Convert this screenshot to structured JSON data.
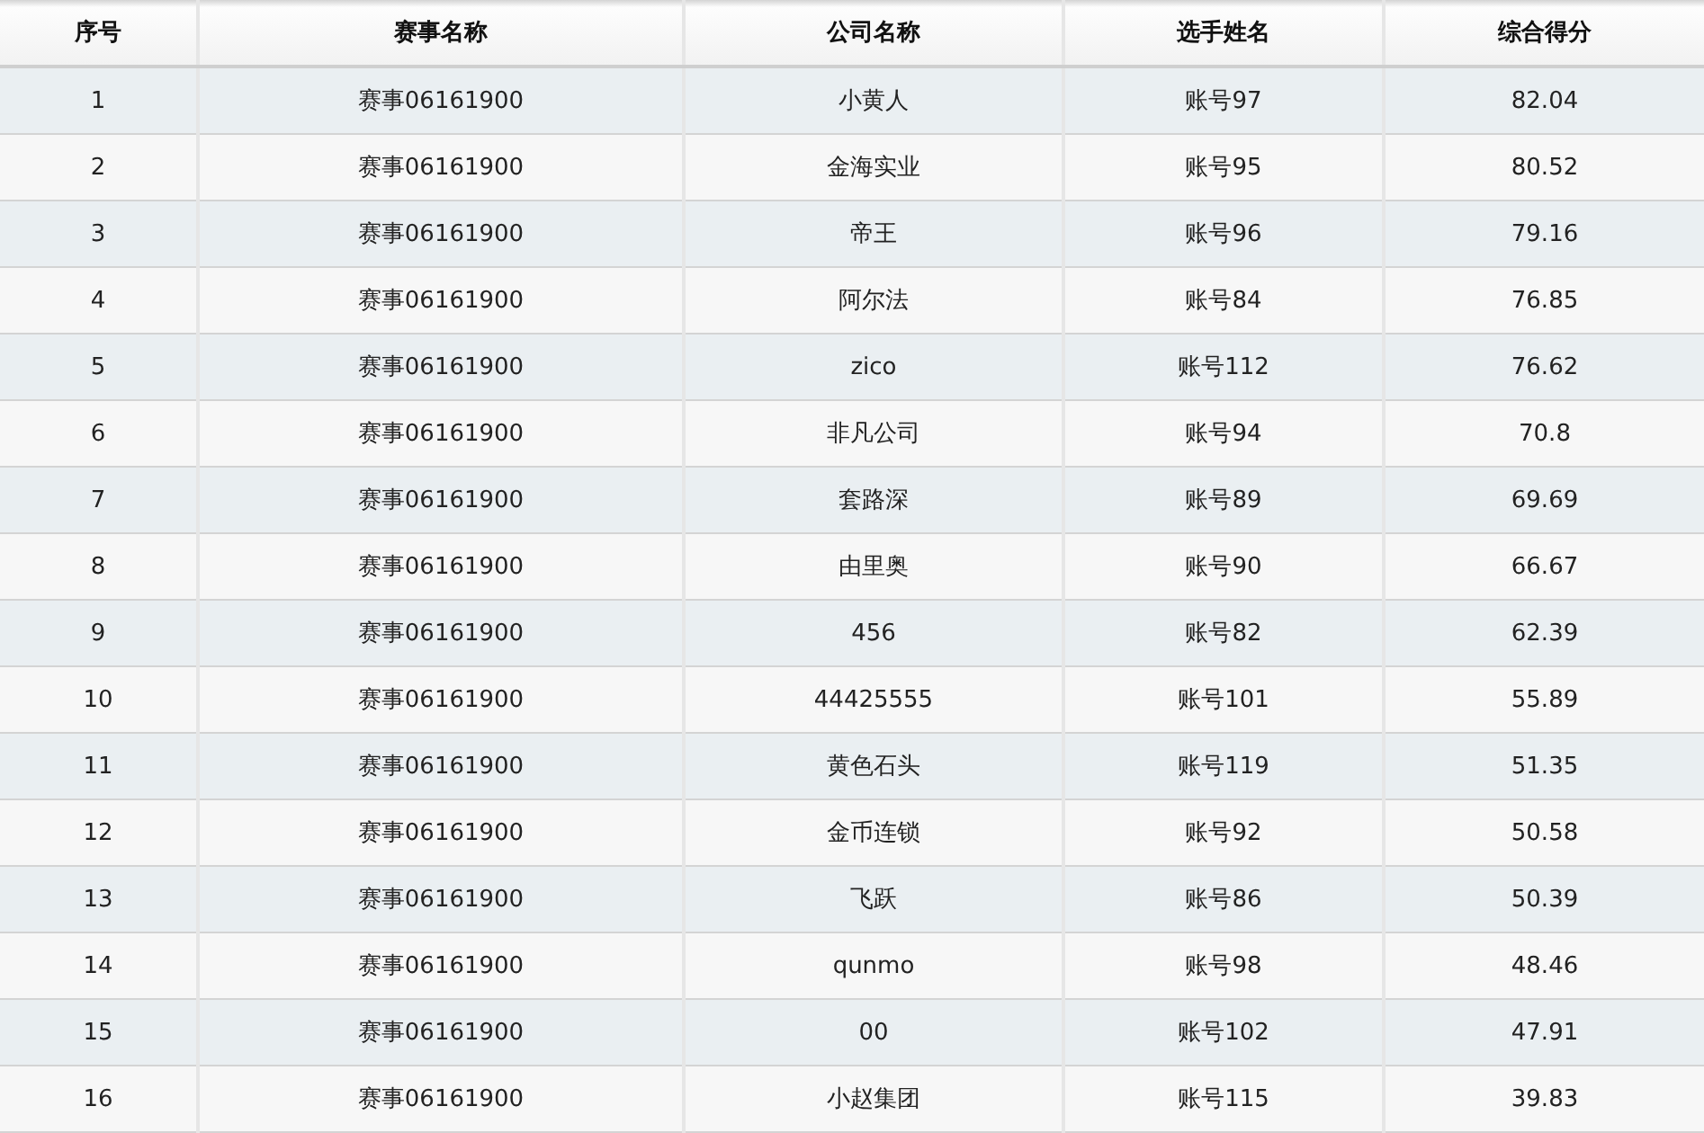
{
  "table": {
    "columns": [
      "序号",
      "赛事名称",
      "公司名称",
      "选手姓名",
      "综合得分"
    ],
    "rows": [
      [
        "1",
        "赛事06161900",
        "小黄人",
        "账号97",
        "82.04"
      ],
      [
        "2",
        "赛事06161900",
        "金海实业",
        "账号95",
        "80.52"
      ],
      [
        "3",
        "赛事06161900",
        "帝王",
        "账号96",
        "79.16"
      ],
      [
        "4",
        "赛事06161900",
        "阿尔法",
        "账号84",
        "76.85"
      ],
      [
        "5",
        "赛事06161900",
        "zico",
        "账号112",
        "76.62"
      ],
      [
        "6",
        "赛事06161900",
        "非凡公司",
        "账号94",
        "70.8"
      ],
      [
        "7",
        "赛事06161900",
        "套路深",
        "账号89",
        "69.69"
      ],
      [
        "8",
        "赛事06161900",
        "由里奥",
        "账号90",
        "66.67"
      ],
      [
        "9",
        "赛事06161900",
        "456",
        "账号82",
        "62.39"
      ],
      [
        "10",
        "赛事06161900",
        "44425555",
        "账号101",
        "55.89"
      ],
      [
        "11",
        "赛事06161900",
        "黄色石头",
        "账号119",
        "51.35"
      ],
      [
        "12",
        "赛事06161900",
        "金币连锁",
        "账号92",
        "50.58"
      ],
      [
        "13",
        "赛事06161900",
        "飞跃",
        "账号86",
        "50.39"
      ],
      [
        "14",
        "赛事06161900",
        "qunmo",
        "账号98",
        "48.46"
      ],
      [
        "15",
        "赛事06161900",
        "00",
        "账号102",
        "47.91"
      ],
      [
        "16",
        "赛事06161900",
        "小赵集团",
        "账号115",
        "39.83"
      ]
    ]
  }
}
